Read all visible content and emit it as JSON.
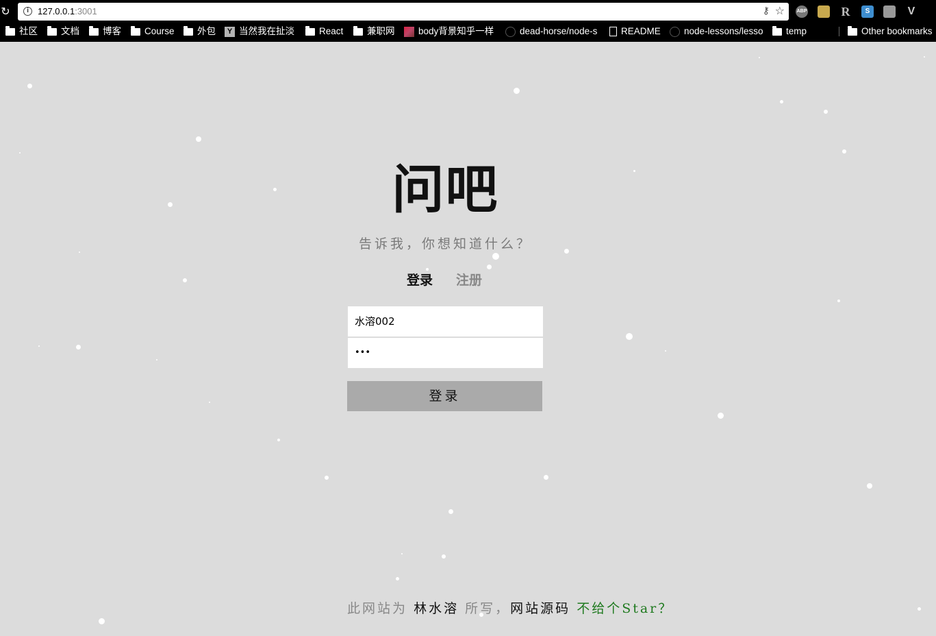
{
  "browser": {
    "url_host": "127.0.0.1",
    "url_port": ":3001",
    "extensions": [
      {
        "name": "adblock-icon",
        "glyph": "ABP"
      },
      {
        "name": "image-extension-icon",
        "glyph": ""
      },
      {
        "name": "r-extension-icon",
        "glyph": "R"
      },
      {
        "name": "s-extension-icon",
        "glyph": "S"
      },
      {
        "name": "table-extension-icon",
        "glyph": ""
      },
      {
        "name": "vue-devtools-icon",
        "glyph": "V"
      }
    ],
    "bookmarks": [
      {
        "label": "社区",
        "icon": "folder-icon"
      },
      {
        "label": "文档",
        "icon": "folder-icon"
      },
      {
        "label": "博客",
        "icon": "folder-icon"
      },
      {
        "label": "Course",
        "icon": "folder-icon"
      },
      {
        "label": "外包",
        "icon": "folder-icon"
      },
      {
        "label": "当然我在扯淡",
        "icon": "ycombinator-icon"
      },
      {
        "label": "React",
        "icon": "folder-icon"
      },
      {
        "label": "兼职网",
        "icon": "folder-icon"
      },
      {
        "label": "body背景知乎一样",
        "icon": "image-icon"
      },
      {
        "label": "dead-horse/node-s",
        "icon": "github-icon"
      },
      {
        "label": "README",
        "icon": "page-icon"
      },
      {
        "label": "node-lessons/lesso",
        "icon": "github-icon"
      },
      {
        "label": "temp",
        "icon": "folder-icon"
      },
      {
        "label": "Other bookmarks",
        "icon": "folder-icon"
      }
    ]
  },
  "page": {
    "title": "问吧",
    "subtitle": "告诉我，你想知道什么？",
    "tabs": {
      "login": "登录",
      "register": "注册",
      "active": "login"
    },
    "form": {
      "username_value": "水溶002",
      "password_value": "•••",
      "submit_label": "登录"
    },
    "footer": {
      "prefix": "此网站为",
      "author": "林水溶",
      "middle": "所写，",
      "source_link": "网站源码",
      "star_link": "不给个Star？"
    }
  },
  "colors": {
    "background": "#dcdcdc",
    "button": "#aaaaaa",
    "star_link": "#1f7a1f"
  }
}
